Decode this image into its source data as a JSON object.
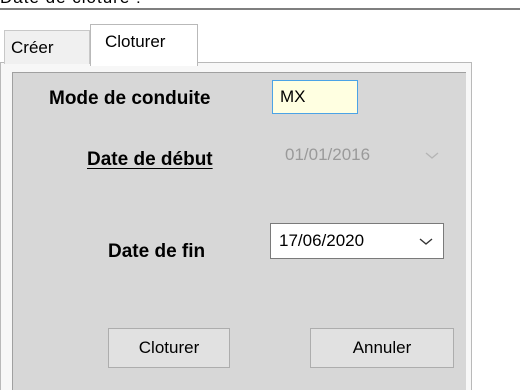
{
  "window": {
    "title_fragment": "Date de clôture :"
  },
  "tabs": [
    {
      "label": "Créer"
    },
    {
      "label": "Cloturer"
    }
  ],
  "form": {
    "mode_label": "Mode de conduite",
    "mode_value": "MX",
    "start_date_label": "Date de début",
    "start_date_value": "01/01/2016",
    "end_date_label": "Date de fin",
    "end_date_value": "17/06/2020"
  },
  "buttons": {
    "close": "Cloturer",
    "cancel": "Annuler"
  },
  "icons": {
    "dropdown": "chevron-down-icon"
  },
  "colors": {
    "panel_bg": "#d7d7d7",
    "field_bg": "#ffffe1",
    "field_border": "#4ba3e6",
    "disabled_text": "#9a9a9a"
  }
}
